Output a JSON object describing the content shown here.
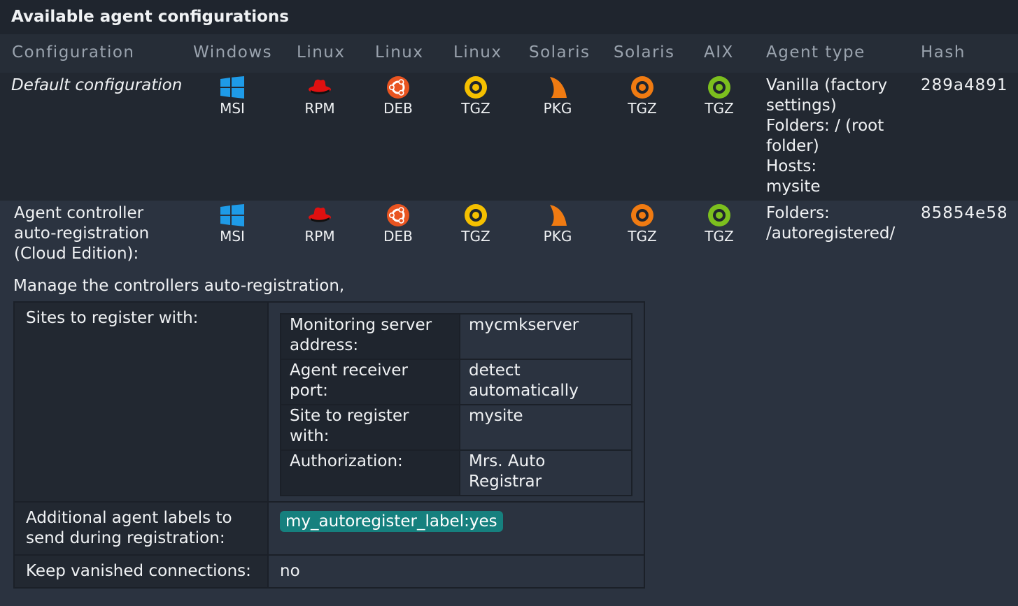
{
  "panel": {
    "title": "Available agent configurations"
  },
  "table": {
    "headers": {
      "configuration": "Configuration",
      "windows": "Windows",
      "linux1": "Linux",
      "linux2": "Linux",
      "linux3": "Linux",
      "solaris1": "Solaris",
      "solaris2": "Solaris",
      "aix": "AIX",
      "agent_type": "Agent type",
      "hash": "Hash"
    },
    "rows": [
      {
        "name": "Default configuration",
        "packages": {
          "windows": "MSI",
          "linux1": "RPM",
          "linux2": "DEB",
          "linux3": "TGZ",
          "solaris1": "PKG",
          "solaris2": "TGZ",
          "aix": "TGZ"
        },
        "agent_type": {
          "l1": "Vanilla (factory",
          "l2": "settings)",
          "l3": "Folders: / (root",
          "l4": "folder)",
          "l5": "Hosts:",
          "l6": "mysite"
        },
        "hash": "289a4891"
      },
      {
        "name": {
          "l1": "Agent controller",
          "l2": "auto-registration",
          "l3": "(Cloud Edition):"
        },
        "packages": {
          "windows": "MSI",
          "linux1": "RPM",
          "linux2": "DEB",
          "linux3": "TGZ",
          "solaris1": "PKG",
          "solaris2": "TGZ",
          "aix": "TGZ"
        },
        "agent_type": {
          "l1": "Folders:",
          "l2": "/autoregistered/"
        },
        "hash": "85854e58"
      }
    ]
  },
  "autoreg": {
    "intro": "Manage the controllers auto-registration,",
    "sites_label": "Sites to register with:",
    "sites": [
      {
        "key": "Monitoring server address:",
        "value": "mycmkserver"
      },
      {
        "key": "Agent receiver port:",
        "value": "detect automatically"
      },
      {
        "key": "Site to register with:",
        "value": "mysite"
      },
      {
        "key": "Authorization:",
        "value": "Mrs. Auto Registrar"
      }
    ],
    "labels_label": "Additional agent labels to send during registration:",
    "label_chip": "my_autoregister_label:yes",
    "keep_label": "Keep vanished connections:",
    "keep_value": "no"
  },
  "colors": {
    "background": "#2b3340",
    "title_bar": "#1f252e",
    "windows_icon": "#1e9be8",
    "redhat_icon": "#e01010",
    "ubuntu_icon": "#e95420",
    "linux_tgz_icon": "#f5c000",
    "solaris_pkg_icon": "#f07b12",
    "solaris_tgz_icon": "#f07b12",
    "aix_icon": "#7cbf1e",
    "label_chip": "#16807e"
  },
  "icons": {
    "windows": "windows-logo-icon",
    "linux1": "redhat-logo-icon",
    "linux2": "ubuntu-logo-icon",
    "linux3": "tgz-archive-icon",
    "solaris1": "solaris-logo-icon",
    "solaris2": "tgz-archive-icon",
    "aix": "tgz-archive-icon"
  }
}
